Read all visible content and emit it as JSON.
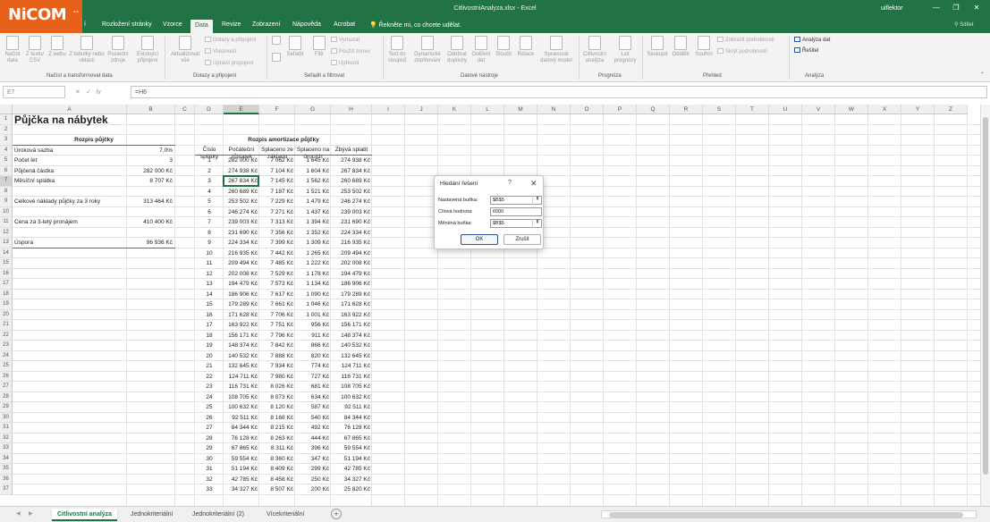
{
  "logo": {
    "text": "NiCOM",
    "sub": "a.s."
  },
  "window": {
    "title": "CitlivostniAnalyza.xlsx  -  Excel",
    "user": "uiflektor",
    "share": "Sdílet"
  },
  "menu": {
    "items": [
      "Rozložení stránky",
      "Vzorce",
      "Data",
      "Revize",
      "Zobrazení",
      "Nápověda",
      "Acrobat"
    ],
    "partial": "í",
    "search": "Řekněte mi, co chcete udělat."
  },
  "ribbon": {
    "get": [
      "Načíst data",
      "Z textu/ CSV",
      "Z webu",
      "Z tabulky nebo oblasti",
      "Poslední zdroje",
      "Existující připojení"
    ],
    "refresh": "Aktualizovat vše",
    "connections": [
      "Dotazy a připojení",
      "Vlastnosti",
      "Upravit propojení"
    ],
    "sort_az": "Seřadit",
    "filter": "Filtr",
    "filter_small": [
      "Vymazat",
      "Použít znovu",
      "Upřesnit"
    ],
    "tools": [
      "Text do sloupců",
      "Dynamické doplňování",
      "Odebrat duplicity",
      "Ověření dat",
      "Sloučit",
      "Relace",
      "Spravovat datový model"
    ],
    "forecast": [
      "Citlivostní analýza",
      "List prognózy"
    ],
    "outline": [
      "Seskupit",
      "Oddělit",
      "Souhrn"
    ],
    "outline_small": [
      "Zobrazit podrobnosti",
      "Skrýt podrobnosti"
    ],
    "analysis": [
      "Analýza dat",
      "Řešitel"
    ],
    "groups": [
      "Načíst a transformovat data",
      "Dotazy a připojení",
      "Seřadit a filtrovat",
      "Datové nástroje",
      "Prognóza",
      "Přehled",
      "Analýza"
    ]
  },
  "formula_bar": {
    "name_box": "E7",
    "fx": "fx",
    "formula": "=H6"
  },
  "columns": [
    "A",
    "B",
    "C",
    "D",
    "E",
    "F",
    "G",
    "H",
    "I",
    "J",
    "K",
    "L",
    "M",
    "N",
    "O",
    "P",
    "Q",
    "R",
    "S",
    "T",
    "U",
    "V",
    "W",
    "X",
    "Y",
    "Z"
  ],
  "rows": [
    "1",
    "2",
    "3",
    "4",
    "5",
    "6",
    "7",
    "8",
    "9",
    "10",
    "11",
    "12",
    "13",
    "14",
    "15",
    "16",
    "17",
    "18",
    "19",
    "20",
    "21",
    "22",
    "23",
    "24",
    "25",
    "26",
    "27",
    "28",
    "29",
    "30",
    "31",
    "32",
    "33",
    "34",
    "35",
    "36",
    "37"
  ],
  "sheet": {
    "title": "Půjčka na nábytek",
    "loan_header": "Rozpis půjčky",
    "amort_header": "Rozpis amortizace půjčky",
    "labels": [
      "Úroková sazba",
      "Počet let",
      "Půjčená částka",
      "Měsíční splátka",
      "Celkové náklady půjčky za 3 roky",
      "Cena za 3-letý pronájem",
      "Úspora"
    ],
    "values": [
      "7,0%",
      "3",
      "282 000 Kč",
      "8 707 Kč",
      "313 464 Kč",
      "410 400 Kč",
      "96 936 Kč"
    ],
    "col_headers": [
      "Číslo splátky",
      "Počáteční zůstatek",
      "Splaceno ze základu",
      "Splaceno na úrocích",
      "Zbývá splatit"
    ],
    "amort": [
      [
        "1",
        "282 000 Kč",
        "7 062 Kč",
        "1 645 Kč",
        "274 938 Kč"
      ],
      [
        "2",
        "274 938 Kč",
        "7 104 Kč",
        "1 604 Kč",
        "267 834 Kč"
      ],
      [
        "3",
        "267 834 Kč",
        "7 145 Kč",
        "1 562 Kč",
        "260 689 Kč"
      ],
      [
        "4",
        "260 689 Kč",
        "7 187 Kč",
        "1 521 Kč",
        "253 502 Kč"
      ],
      [
        "5",
        "253 502 Kč",
        "7 229 Kč",
        "1 479 Kč",
        "246 274 Kč"
      ],
      [
        "6",
        "246 274 Kč",
        "7 271 Kč",
        "1 437 Kč",
        "239 003 Kč"
      ],
      [
        "7",
        "239 003 Kč",
        "7 313 Kč",
        "1 394 Kč",
        "231 690 Kč"
      ],
      [
        "8",
        "231 690 Kč",
        "7 356 Kč",
        "1 352 Kč",
        "224 334 Kč"
      ],
      [
        "9",
        "224 334 Kč",
        "7 399 Kč",
        "1 309 Kč",
        "216 935 Kč"
      ],
      [
        "10",
        "216 935 Kč",
        "7 442 Kč",
        "1 265 Kč",
        "209 494 Kč"
      ],
      [
        "11",
        "209 494 Kč",
        "7 485 Kč",
        "1 222 Kč",
        "202 008 Kč"
      ],
      [
        "12",
        "202 008 Kč",
        "7 529 Kč",
        "1 178 Kč",
        "194 479 Kč"
      ],
      [
        "13",
        "194 479 Kč",
        "7 573 Kč",
        "1 134 Kč",
        "186 906 Kč"
      ],
      [
        "14",
        "186 906 Kč",
        "7 617 Kč",
        "1 090 Kč",
        "179 289 Kč"
      ],
      [
        "15",
        "179 289 Kč",
        "7 661 Kč",
        "1 046 Kč",
        "171 628 Kč"
      ],
      [
        "16",
        "171 628 Kč",
        "7 706 Kč",
        "1 001 Kč",
        "163 922 Kč"
      ],
      [
        "17",
        "163 922 Kč",
        "7 751 Kč",
        "956 Kč",
        "156 171 Kč"
      ],
      [
        "18",
        "156 171 Kč",
        "7 796 Kč",
        "911 Kč",
        "148 374 Kč"
      ],
      [
        "19",
        "148 374 Kč",
        "7 842 Kč",
        "866 Kč",
        "140 532 Kč"
      ],
      [
        "20",
        "140 532 Kč",
        "7 888 Kč",
        "820 Kč",
        "132 645 Kč"
      ],
      [
        "21",
        "132 645 Kč",
        "7 934 Kč",
        "774 Kč",
        "124 711 Kč"
      ],
      [
        "22",
        "124 711 Kč",
        "7 980 Kč",
        "727 Kč",
        "116 731 Kč"
      ],
      [
        "23",
        "116 731 Kč",
        "8 026 Kč",
        "681 Kč",
        "108 705 Kč"
      ],
      [
        "24",
        "108 705 Kč",
        "8 073 Kč",
        "634 Kč",
        "100 632 Kč"
      ],
      [
        "25",
        "100 632 Kč",
        "8 120 Kč",
        "587 Kč",
        "92 511 Kč"
      ],
      [
        "26",
        "92 511 Kč",
        "8 168 Kč",
        "540 Kč",
        "84 344 Kč"
      ],
      [
        "27",
        "84 344 Kč",
        "8 215 Kč",
        "492 Kč",
        "76 128 Kč"
      ],
      [
        "28",
        "76 128 Kč",
        "8 263 Kč",
        "444 Kč",
        "67 865 Kč"
      ],
      [
        "29",
        "67 865 Kč",
        "8 311 Kč",
        "396 Kč",
        "59 554 Kč"
      ],
      [
        "30",
        "59 554 Kč",
        "8 360 Kč",
        "347 Kč",
        "51 194 Kč"
      ],
      [
        "31",
        "51 194 Kč",
        "8 409 Kč",
        "299 Kč",
        "42 785 Kč"
      ],
      [
        "32",
        "42 785 Kč",
        "8 458 Kč",
        "250 Kč",
        "34 327 Kč"
      ],
      [
        "33",
        "34 327 Kč",
        "8 507 Kč",
        "200 Kč",
        "25 820 Kč"
      ]
    ]
  },
  "dialog": {
    "title": "Hledání řešení",
    "help": "?",
    "close": "✕",
    "set_cell_label": "Nastavená buňka:",
    "set_cell_value": "$B$5",
    "target_label": "Cílová hodnota:",
    "target_value": "6000",
    "changing_label": "Měněná buňka:",
    "changing_value": "$B$5",
    "ok": "OK",
    "cancel": "Zrušit"
  },
  "tabs": {
    "sheets": [
      "Citlivostní analýza",
      "Jednokriteriální",
      "Jednokriteriální (2)",
      "Vícekriteriální"
    ],
    "active": 0,
    "add": "+"
  }
}
